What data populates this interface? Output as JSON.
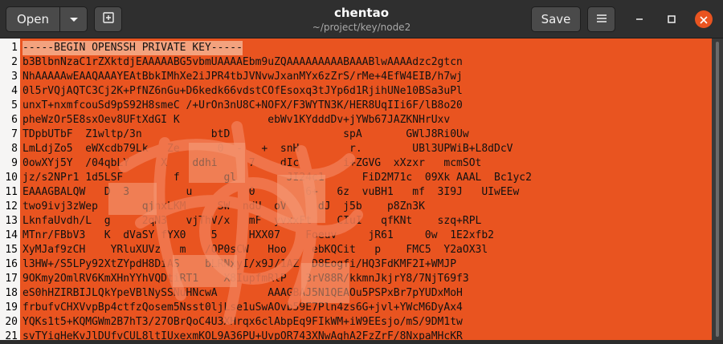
{
  "window": {
    "title": "chentao",
    "subtitle": "~/project/key/node2"
  },
  "toolbar": {
    "open_label": "Open",
    "save_label": "Save",
    "open_arrow_icon": "chevron-down-icon",
    "new_document_icon": "new-document-icon",
    "menu_icon": "hamburger-menu-icon"
  },
  "controls": {
    "minimize_icon": "minimize-icon",
    "maximize_icon": "maximize-icon",
    "close_icon": "close-icon"
  },
  "colors": {
    "accent": "#e95420",
    "headerbar": "#2f2f2f",
    "gutter": "#f6f5f4"
  },
  "editor": {
    "lines": [
      {
        "num": "1",
        "text": "-----BEGIN OPENSSH PRIVATE KEY-----"
      },
      {
        "num": "2",
        "text": "b3BlbnNzaC1rZXktdjEAAAAABG5vbmUAAAAEbm9uZQAAAAAAAAABAAABlwAAAAdzc2gtcn"
      },
      {
        "num": "3",
        "text": "NhAAAAAwEAAQAAAYEAtBbkIMhXe2iJPR4tbJVNvwJxanMYx6zZrS/rMe+4EfW4EIB/h7wj"
      },
      {
        "num": "4",
        "text": "0l5rVQjAQTC3Cj2K+PfNZ6nGu+D6kedk66vdstCOfEsoxq3tJYp6d1RjihUNe10BSa3uPl"
      },
      {
        "num": "5",
        "text": "unxT+nxmfcouSd9pS92H8smeC /+UrOn3nU8C+NOFX/F3WYTN3K/HER8UqIIi6F/lB8o20"
      },
      {
        "num": "6",
        "text": "pheWzOr5E8sxOev8UFtXdGI K              ebWv1KYdddDv+jYWb67JAZKNHrUxv"
      },
      {
        "num": "7",
        "text": "TDpbUTbF  Z1wltp/3n           btD                  spA       GWlJ8Ri0Uw"
      },
      {
        "num": "8",
        "text": "LmLdjZo5  eWXcdb79Lk   Ze      0  -   +  snH        r.        UBl3UPWiB+L8dDcV"
      },
      {
        "num": "9",
        "text": "0owXYj5Y  /04qbLY     X    ddhi     7    dIc       i+ZGVG  xXzxr   mcmSOt"
      },
      {
        "num": "10",
        "text": "jz/s2NPr1 1d5LSF        f       gl        JI24c1      FiD2M71c  09Xk AAAL  Bc1yc2"
      },
      {
        "num": "11",
        "text": "EAAAGBALQW   D  3         u         0        6+   6z  vuBH1   mf  3I9J   UIwEEw"
      },
      {
        "num": "12",
        "text": "two9ivj3zWep       qjnxLKM     SW  ndU  oV     dJ  j5b    p8Zn3K"
      },
      {
        "num": "13",
        "text": "LknfaUvdh/L  g     2qN3   vjThV/x   mF  yvxxFt    CIuI   qfKNt    szq+RPL"
      },
      {
        "num": "14",
        "text": "MTnr/FBbV3   K  dVaSY fYX0    5     HXX07    Foeuv     jR61     0w  1E2xfb2"
      },
      {
        "num": "15",
        "text": "XyMJaf9zCH    YRluXUVz   m   /OP0sCW   Hoo    ebKQCit   p    FMC5  Y2aOX3l"
      },
      {
        "num": "16",
        "text": "l3HW+/S5LPy92XtZYpdH8DiAS    bLRNxyI/x9J/1AZ  D8Eogfi/HQ3FdKMF2I+WMJP"
      },
      {
        "num": "17",
        "text": "9OKmy2OmlRV6KmXHnYYhVQDtiRT1    X8IupfmRlP   3rV88R/kkmnJkjrY8/7NjT69f3"
      },
      {
        "num": "18",
        "text": "eS0hHZIRBIJLQkYpeVBlNySSNuHNcwA        AAAGBAJ5N1QEAOu5PSPxBr7pYUDxMoH"
      },
      {
        "num": "19",
        "text": "frbufvCHXVvpBp4ctfzQosem5Nsst0ljLse1uSwAOvb59E7Pln4zs6G+jvl+YWcM6DyAx4"
      },
      {
        "num": "20",
        "text": "YQKs1t5+KQMGWm2B7hT3/27OBrQoC4U3XHrqx6clAbpEq9FIkWM+iW9EEsjo/mS/9DM1tw"
      },
      {
        "num": "21",
        "text": "svTYigHeKvJlDUfvCUL8ltIUxexmKOL9A36PU+UvpOR743XNwAghA2FzZrF/8NxpaMHcKR"
      }
    ]
  }
}
